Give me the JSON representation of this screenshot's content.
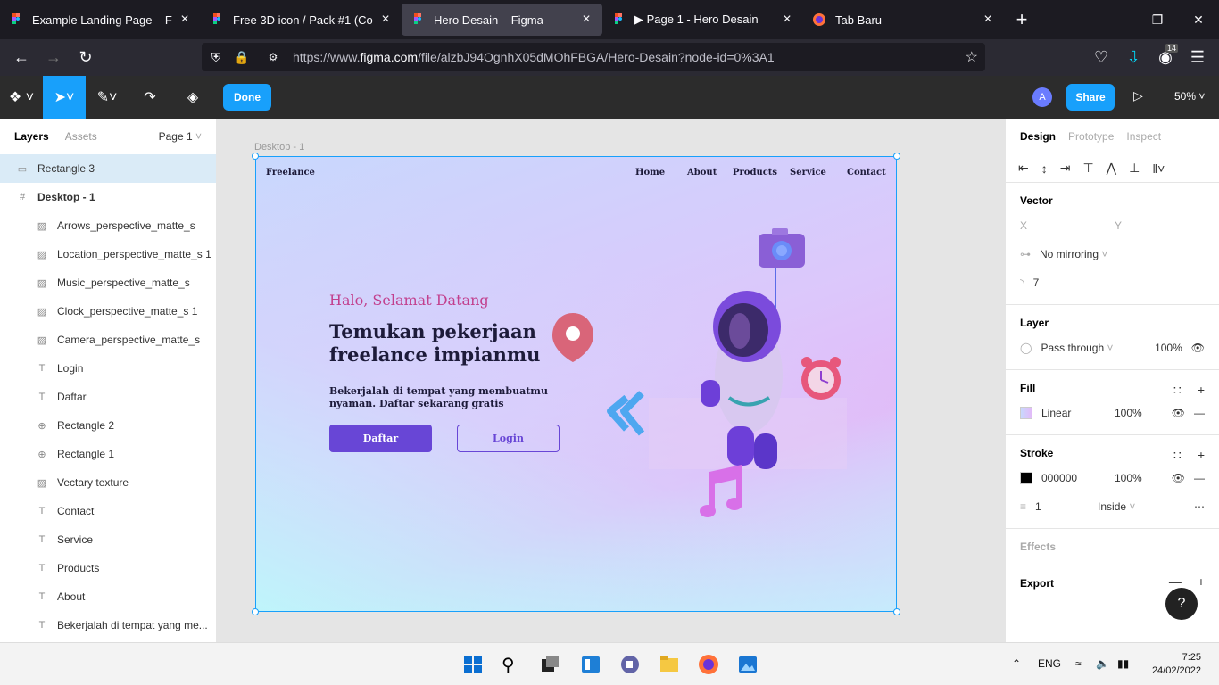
{
  "browser": {
    "tabs": [
      {
        "title": "Example Landing Page – Figma",
        "icon": "figma-icon"
      },
      {
        "title": "Free 3D icon / Pack #1 (Commu",
        "icon": "figma-icon"
      },
      {
        "title": "Hero Desain – Figma",
        "icon": "figma-icon",
        "active": true
      },
      {
        "title": "▶ Page 1 - Hero Desain",
        "icon": "figma-icon"
      },
      {
        "title": "Tab Baru",
        "icon": "firefox-icon"
      }
    ],
    "url_prefix": "https://www.",
    "url_domain": "figma.com",
    "url_rest": "/file/alzbJ94OgnhX05dMOhFBGA/Hero-Desain?node-id=0%3A1",
    "notif_count": "14"
  },
  "toolbar": {
    "done_label": "Done",
    "share_label": "Share",
    "avatar_letter": "A",
    "zoom": "50%"
  },
  "layers_panel": {
    "tab_layers": "Layers",
    "tab_assets": "Assets",
    "page": "Page 1",
    "items": [
      {
        "label": "Rectangle 3",
        "type": "rect",
        "indent": 0,
        "selected": true
      },
      {
        "label": "Desktop - 1",
        "type": "frame",
        "indent": 0,
        "bold": true
      },
      {
        "label": "Arrows_perspective_matte_s",
        "type": "image",
        "indent": 1
      },
      {
        "label": "Location_perspective_matte_s 1",
        "type": "image",
        "indent": 1
      },
      {
        "label": "Music_perspective_matte_s",
        "type": "image",
        "indent": 1
      },
      {
        "label": "Clock_perspective_matte_s 1",
        "type": "image",
        "indent": 1
      },
      {
        "label": "Camera_perspective_matte_s",
        "type": "image",
        "indent": 1
      },
      {
        "label": "Login",
        "type": "text",
        "indent": 1
      },
      {
        "label": "Daftar",
        "type": "text",
        "indent": 1
      },
      {
        "label": "Rectangle 2",
        "type": "rect",
        "indent": 1
      },
      {
        "label": "Rectangle 1",
        "type": "rect",
        "indent": 1
      },
      {
        "label": "Vectary texture",
        "type": "image",
        "indent": 1
      },
      {
        "label": "Contact",
        "type": "text",
        "indent": 1
      },
      {
        "label": "Service",
        "type": "text",
        "indent": 1
      },
      {
        "label": "Products",
        "type": "text",
        "indent": 1
      },
      {
        "label": "About",
        "type": "text",
        "indent": 1
      },
      {
        "label": "Bekerjalah di tempat yang me...",
        "type": "text",
        "indent": 1
      }
    ]
  },
  "canvas": {
    "frame_label": "Desktop - 1",
    "brand": "Freelance",
    "nav": [
      "Home",
      "About",
      "Products",
      "Service",
      "Contact"
    ],
    "greeting": "Halo, Selamat Datang",
    "headline": "Temukan pekerjaan freelance impianmu",
    "subtext": "Bekerjalah di tempat yang membuatmu nyaman. Daftar sekarang gratis",
    "btn_daftar": "Daftar",
    "btn_login": "Login"
  },
  "design_panel": {
    "tab_design": "Design",
    "tab_prototype": "Prototype",
    "tab_inspect": "Inspect",
    "vector_title": "Vector",
    "x_label": "X",
    "y_label": "Y",
    "mirroring": "No mirroring",
    "radius": "7",
    "layer_title": "Layer",
    "blend": "Pass through",
    "layer_opacity": "100%",
    "fill_title": "Fill",
    "fill_type": "Linear",
    "fill_opacity": "100%",
    "stroke_title": "Stroke",
    "stroke_color": "000000",
    "stroke_opacity": "100%",
    "stroke_weight": "1",
    "stroke_position": "Inside",
    "effects_title": "Effects",
    "export_title": "Export"
  },
  "taskbar": {
    "lang": "ENG",
    "time": "7:25",
    "date": "24/02/2022"
  }
}
